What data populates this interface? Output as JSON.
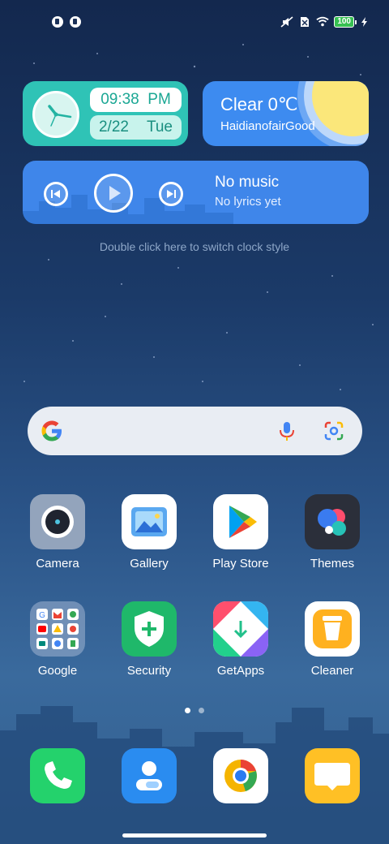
{
  "status_bar": {
    "battery_level": "100"
  },
  "clock_widget": {
    "time": "09:38",
    "ampm": "PM",
    "date": "2/22",
    "weekday": "Tue"
  },
  "weather_widget": {
    "condition_temp": "Clear 0℃",
    "location_line": "HaidianofairGood"
  },
  "music_widget": {
    "title": "No music",
    "subtitle": "No lyrics yet"
  },
  "hint": "Double click here to switch clock style",
  "apps_row1": [
    {
      "label": "Camera"
    },
    {
      "label": "Gallery"
    },
    {
      "label": "Play Store"
    },
    {
      "label": "Themes"
    }
  ],
  "apps_row2": [
    {
      "label": "Google"
    },
    {
      "label": "Security"
    },
    {
      "label": "GetApps"
    },
    {
      "label": "Cleaner"
    }
  ],
  "colors": {
    "clock_bg": "#2fc3b6",
    "weather_bg": "#3d8bf0",
    "music_bg": "#3f86ea",
    "phone_green": "#26d36b",
    "contacts_blue": "#2a8cf0",
    "messages_yellow": "#ffc025"
  }
}
